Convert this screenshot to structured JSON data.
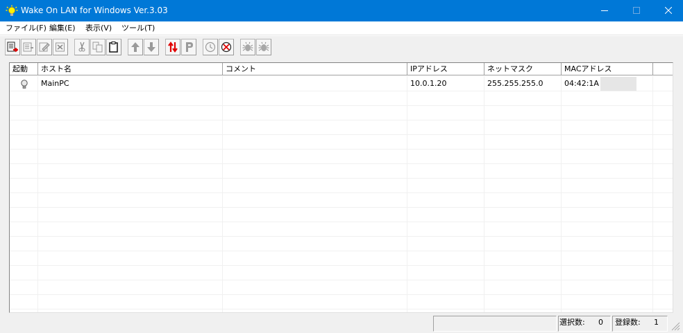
{
  "window": {
    "title": "Wake On LAN for Windows Ver.3.03",
    "titlebar_color": "#0078d7",
    "icon": "lightbulb-icon"
  },
  "menu": [
    "ファイル(F)",
    "編集(E)",
    "表示(V)",
    "ツール(T)"
  ],
  "toolbar": {
    "buttons": [
      {
        "icon": "add-host-icon"
      },
      {
        "icon": "edit-host-icon"
      },
      {
        "icon": "edit-note-icon"
      },
      {
        "icon": "delete-host-icon"
      },
      {
        "icon": "cut-icon"
      },
      {
        "icon": "copy-icon"
      },
      {
        "icon": "paste-icon"
      },
      {
        "icon": "move-up-icon"
      },
      {
        "icon": "move-down-icon"
      },
      {
        "icon": "swap-icon"
      },
      {
        "icon": "p-icon"
      },
      {
        "icon": "clock-icon"
      },
      {
        "icon": "clock-cancel-icon"
      },
      {
        "icon": "bug-icon"
      },
      {
        "icon": "bug-double-icon"
      }
    ]
  },
  "table": {
    "columns": [
      "起動",
      "ホスト名",
      "コメント",
      "IPアドレス",
      "ネットマスク",
      "MACアドレス"
    ],
    "rows": [
      {
        "status_icon": "bulb-off-icon",
        "host": "MainPC",
        "comment": "",
        "ip": "10.0.1.20",
        "netmask": "255.255.255.0",
        "mac": "04:42:1A"
      }
    ]
  },
  "status": {
    "selected_label": "選択数:",
    "selected_count": "0",
    "registered_label": "登録数:",
    "registered_count": "1"
  }
}
